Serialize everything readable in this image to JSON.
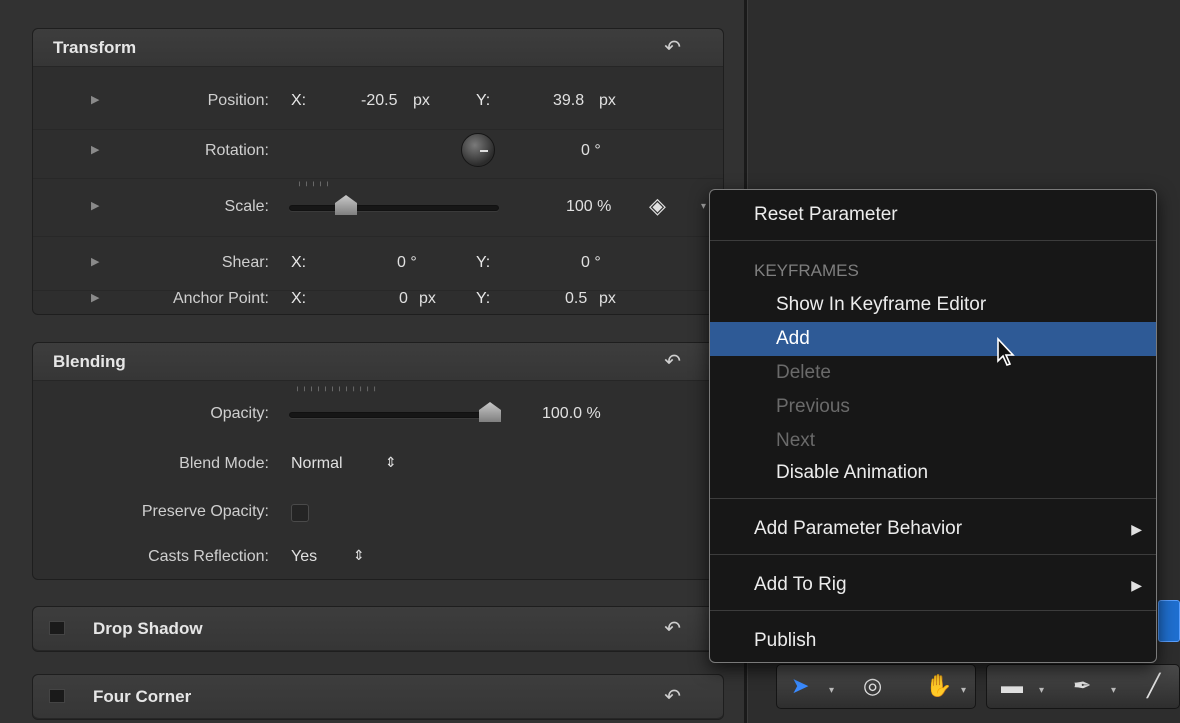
{
  "transform": {
    "title": "Transform",
    "rows": [
      {
        "label": "Position:",
        "x_axis": "X:",
        "x_value": "-20.5",
        "x_unit": "px",
        "y_axis": "Y:",
        "y_value": "39.8",
        "y_unit": "px"
      },
      {
        "label": "Rotation:",
        "value": "0 °"
      },
      {
        "label": "Scale:",
        "value": "100 %"
      },
      {
        "label": "Shear:",
        "x_axis": "X:",
        "x_value": "0 °",
        "y_axis": "Y:",
        "y_value": "0 °"
      },
      {
        "label": "Anchor Point:",
        "x_axis": "X:",
        "x_value": "0",
        "x_unit": "px",
        "y_axis": "Y:",
        "y_value": "0.5",
        "y_unit": "px"
      }
    ]
  },
  "blending": {
    "title": "Blending",
    "opacity_label": "Opacity:",
    "opacity_value": "100.0 %",
    "blend_mode_label": "Blend Mode:",
    "blend_mode_value": "Normal",
    "preserve_opacity_label": "Preserve Opacity:",
    "casts_reflection_label": "Casts Reflection:",
    "casts_reflection_value": "Yes"
  },
  "drop_shadow": {
    "title": "Drop Shadow"
  },
  "four_corner": {
    "title": "Four Corner"
  },
  "context_menu": {
    "reset_parameter": "Reset Parameter",
    "keyframes_header": "KEYFRAMES",
    "show_in_keyframe_editor": "Show In Keyframe Editor",
    "add": "Add",
    "delete": "Delete",
    "previous": "Previous",
    "next": "Next",
    "disable_animation": "Disable Animation",
    "add_parameter_behavior": "Add Parameter Behavior",
    "add_to_rig": "Add To Rig",
    "publish": "Publish"
  },
  "icons": {
    "reset": "reset-arrow-icon",
    "disclosure": "disclosure-triangle-icon",
    "keyframe": "keyframe-diamond-icon",
    "submenu": "submenu-arrow-icon",
    "select_tool": "arrow-pointer-icon",
    "orbit_tool": "3d-orbit-icon",
    "hand_tool": "hand-icon",
    "shape_tool": "rectangle-icon",
    "pen_tool": "bezier-pen-icon",
    "brush_tool": "paint-brush-icon"
  },
  "colors": {
    "menu_highlight": "#2e5a96",
    "panel_bg": "#323232",
    "menu_bg": "#171717"
  }
}
